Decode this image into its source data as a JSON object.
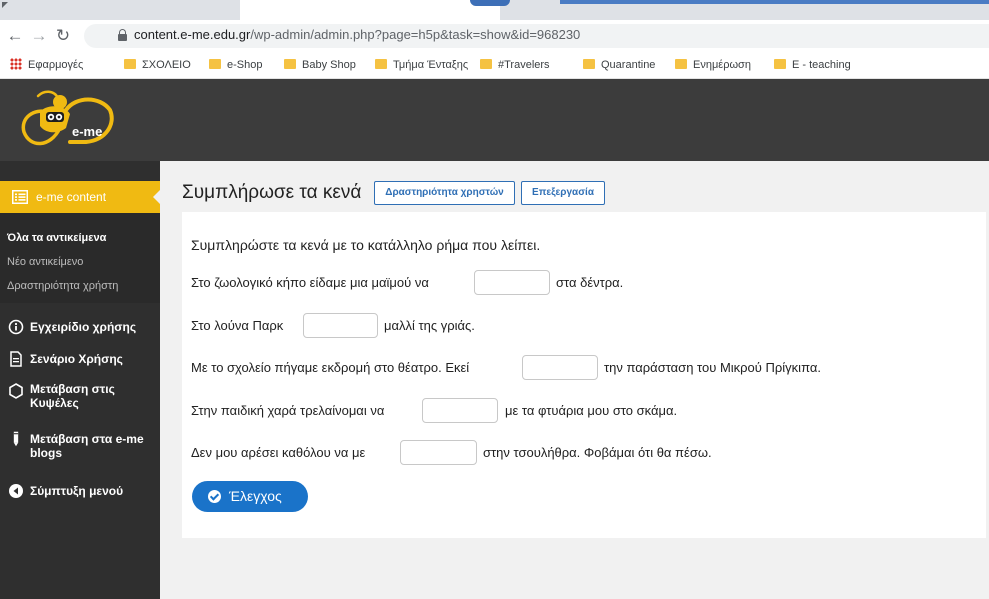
{
  "browser": {
    "url_host": "content.e-me.edu.gr",
    "url_path": "/wp-admin/admin.php?page=h5p&task=show&id=968230",
    "bookmarks": [
      {
        "label": "Εφαρμογές",
        "kind": "apps"
      },
      {
        "label": "ΣΧΟΛΕΙΟ",
        "kind": "folder"
      },
      {
        "label": "e-Shop",
        "kind": "folder"
      },
      {
        "label": "Baby Shop",
        "kind": "folder"
      },
      {
        "label": "Τμήμα Ένταξης",
        "kind": "folder"
      },
      {
        "label": "#Travelers",
        "kind": "folder"
      },
      {
        "label": "Quarantine",
        "kind": "folder"
      },
      {
        "label": "Ενημέρωση",
        "kind": "folder"
      },
      {
        "label": "E - teaching",
        "kind": "folder"
      }
    ]
  },
  "site": {
    "logo_text": "e-me",
    "colors": {
      "header": "#3c3c3c",
      "accent": "#f0ba12",
      "primary": "#1a73c9"
    }
  },
  "sidebar": {
    "active_item": "e-me content",
    "submenu": [
      "Όλα τα αντικείμενα",
      "Νέο αντικείμενο",
      "Δραστηριότητα χρήστη"
    ],
    "items": [
      {
        "label": "Εγχειρίδιο χρήσης",
        "icon": "info-icon"
      },
      {
        "label": "Σενάριο Χρήσης",
        "icon": "document-icon"
      },
      {
        "label_line1": "Μετάβαση στις",
        "label_line2": "Κυψέλες",
        "icon": "hexagon-icon"
      },
      {
        "label_line1": "Μετάβαση στα e-me",
        "label_line2": "blogs",
        "icon": "pen-icon"
      },
      {
        "label": "Σύμπτυξη μενού",
        "icon": "collapse-icon"
      }
    ]
  },
  "main": {
    "title": "Συμπλήρωσε τα κενά",
    "buttons": {
      "activity": "Δραστηριότητα χρηστών",
      "edit": "Επεξεργασία"
    },
    "instruction": "Συμπληρώστε τα κενά με το κατάλληλο ρήμα που λείπει.",
    "sentences": [
      {
        "before": "Στο ζωολογικό κήπο είδαμε μια μαϊμού να",
        "after": "στα δέντρα.",
        "value": ""
      },
      {
        "before": "Στο λούνα Παρκ",
        "after": "μαλλί της γριάς.",
        "value": ""
      },
      {
        "before": "Με το σχολείο πήγαμε εκδρομή στο θέατρο. Εκεί",
        "after": "την παράσταση του Μικρού Πρίγκιπα.",
        "value": ""
      },
      {
        "before": "Στην παιδική χαρά τρελαίνομαι να",
        "after": "με τα φτυάρια μου στο σκάμα.",
        "value": ""
      },
      {
        "before": "Δεν μου αρέσει καθόλου να με",
        "after": "στην τσουλήθρα. Φοβάμαι ότι θα πέσω.",
        "value": ""
      }
    ],
    "check_label": "Έλεγχος"
  }
}
